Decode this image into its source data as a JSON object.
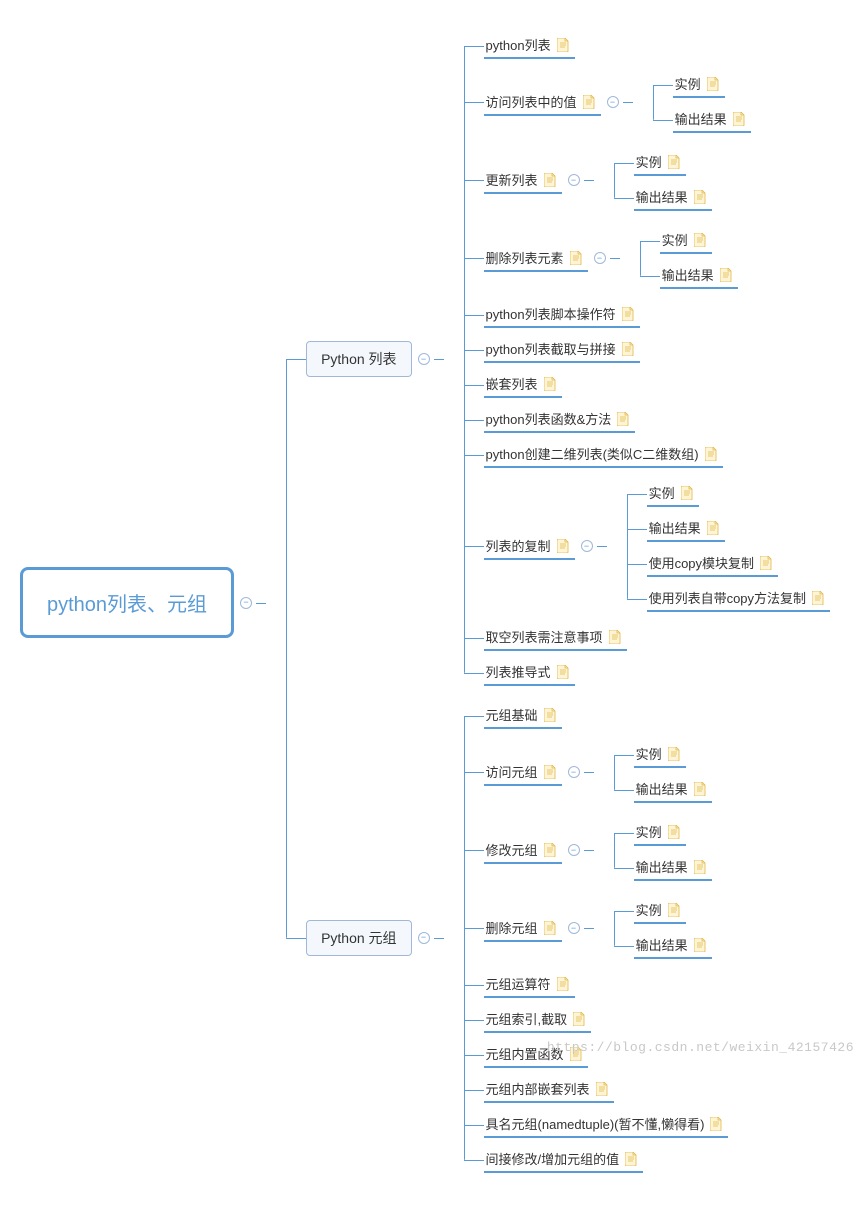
{
  "root": {
    "label": "python列表、元组"
  },
  "branches": [
    {
      "label": "Python 列表",
      "children": [
        {
          "label": "python列表",
          "note": true
        },
        {
          "label": "访问列表中的值",
          "note": true,
          "collapse": true,
          "children": [
            {
              "label": "实例",
              "note": true
            },
            {
              "label": "输出结果",
              "note": true
            }
          ]
        },
        {
          "label": "更新列表",
          "note": true,
          "collapse": true,
          "children": [
            {
              "label": "实例",
              "note": true
            },
            {
              "label": "输出结果",
              "note": true
            }
          ]
        },
        {
          "label": "删除列表元素",
          "note": true,
          "collapse": true,
          "children": [
            {
              "label": "实例",
              "note": true
            },
            {
              "label": "输出结果",
              "note": true
            }
          ]
        },
        {
          "label": "python列表脚本操作符",
          "note": true
        },
        {
          "label": "python列表截取与拼接",
          "note": true
        },
        {
          "label": "嵌套列表",
          "note": true
        },
        {
          "label": "python列表函数&方法",
          "note": true
        },
        {
          "label": "python创建二维列表(类似C二维数组)",
          "note": true
        },
        {
          "label": "列表的复制",
          "note": true,
          "collapse": true,
          "children": [
            {
              "label": "实例",
              "note": true
            },
            {
              "label": "输出结果",
              "note": true
            },
            {
              "label": "使用copy模块复制",
              "note": true
            },
            {
              "label": "使用列表自带copy方法复制",
              "note": true
            }
          ]
        },
        {
          "label": "取空列表需注意事项",
          "note": true
        },
        {
          "label": "列表推导式",
          "note": true
        }
      ]
    },
    {
      "label": "Python 元组",
      "children": [
        {
          "label": "元组基础",
          "note": true
        },
        {
          "label": "访问元组",
          "note": true,
          "collapse": true,
          "children": [
            {
              "label": "实例",
              "note": true
            },
            {
              "label": "输出结果",
              "note": true
            }
          ]
        },
        {
          "label": "修改元组",
          "note": true,
          "collapse": true,
          "children": [
            {
              "label": "实例",
              "note": true
            },
            {
              "label": "输出结果",
              "note": true
            }
          ]
        },
        {
          "label": "删除元组",
          "note": true,
          "collapse": true,
          "children": [
            {
              "label": "实例",
              "note": true
            },
            {
              "label": "输出结果",
              "note": true
            }
          ]
        },
        {
          "label": "元组运算符",
          "note": true
        },
        {
          "label": "元组索引,截取",
          "note": true
        },
        {
          "label": "元组内置函数",
          "note": true
        },
        {
          "label": "元组内部嵌套列表",
          "note": true
        },
        {
          "label": "具名元组(namedtuple)(暂不懂,懒得看)",
          "note": true
        },
        {
          "label": "间接修改/增加元组的值",
          "note": true
        }
      ]
    }
  ],
  "watermark": "https://blog.csdn.net/weixin_42157426",
  "icons": {
    "collapse_symbol": "−"
  }
}
